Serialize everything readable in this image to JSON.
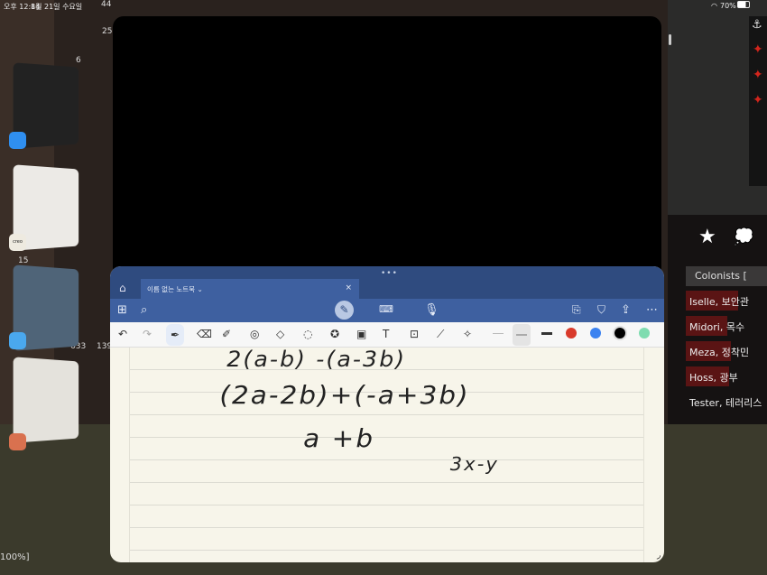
{
  "status_bar": {
    "time": "오후 12:14",
    "date": "8월 21일 수요일",
    "battery": "70%",
    "wifi_icon": "wifi-icon"
  },
  "game": {
    "counts": [
      "44",
      "25",
      "6",
      "15",
      "633",
      "139"
    ],
    "zoom_label": "100%]"
  },
  "stage_manager": {
    "apps": [
      {
        "icon": "safari-icon",
        "color": "#2f8ff0"
      },
      {
        "icon": "creo-icon",
        "label": "creo",
        "color": "#eeeae0"
      },
      {
        "icon": "weather-icon",
        "color": "#4aa8ee"
      },
      {
        "icon": "claude-icon",
        "color": "#d9714f"
      }
    ]
  },
  "notebook": {
    "tab_title": "이름 없는 노트북",
    "tab_chevron": "⌄",
    "close": "×",
    "more": "•••",
    "toolbar_icons": [
      "grid-icon",
      "search-icon",
      "pen-mode-icon",
      "keyboard-icon",
      "microphone-icon",
      "add-page-icon",
      "bookmark-icon",
      "share-icon",
      "more-icon"
    ],
    "pen_tools": [
      "undo-icon",
      "redo-icon",
      "pen-icon",
      "eraser-icon",
      "highlighter-icon",
      "lasso-shape-icon",
      "shapes-icon",
      "lasso-icon",
      "sticker-icon",
      "image-icon",
      "text-icon",
      "image-search-icon",
      "ruler-icon",
      "laser-pointer-icon"
    ],
    "colors": [
      "#d93a2b",
      "#3b82f0",
      "#000000",
      "#7fdcb0"
    ],
    "handwriting": [
      "2(a-b) -(a-3b)",
      "(2a-2b)+(-a+3b)",
      "a +b",
      "3x-y"
    ]
  },
  "colonists": {
    "title": "Colonists [",
    "rows": [
      {
        "text": "Iselle, 보안관",
        "bar": 0.55
      },
      {
        "text": "Midori, 목수",
        "bar": 0.45
      },
      {
        "text": "Meza, 정착민",
        "bar": 0.5
      },
      {
        "text": "Hoss, 광부",
        "bar": 0.48
      },
      {
        "text": "Tester, 테러리스",
        "bar": 0
      }
    ]
  }
}
